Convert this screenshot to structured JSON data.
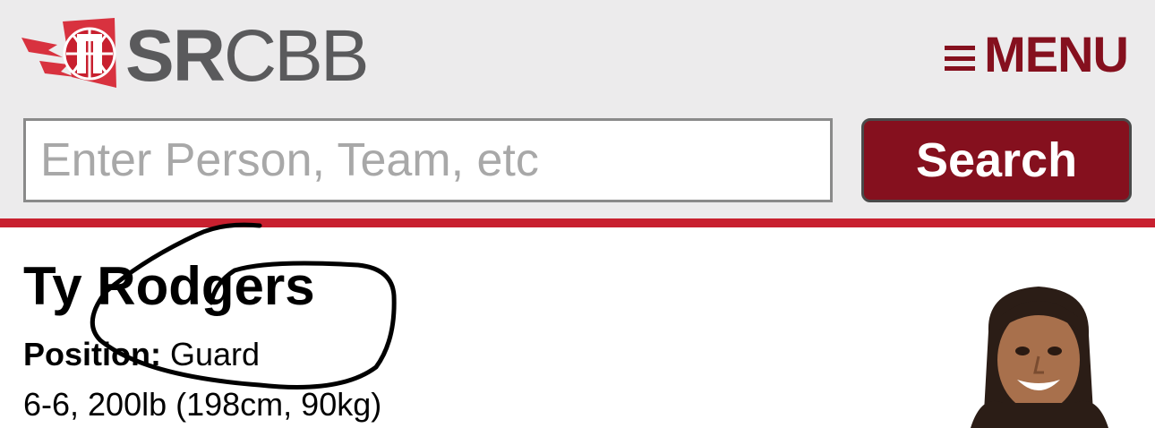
{
  "header": {
    "logo": {
      "bold": "SR",
      "light": "CBB"
    },
    "menu_label": "MENU"
  },
  "search": {
    "placeholder": "Enter Person, Team, etc",
    "value": "",
    "button_label": "Search"
  },
  "player": {
    "name": "Ty Rodgers",
    "position_label": "Position:",
    "position_value": "Guard",
    "size": "6-6, 200lb (198cm, 90kg)"
  },
  "colors": {
    "brand_red": "#85101e",
    "rule_red": "#c8202f",
    "header_bg": "#ecebec",
    "logo_gray": "#5a5a5c"
  },
  "icons": [
    "basketball-flag-logo-icon",
    "hamburger-menu-icon",
    "player-headshot",
    "pen-scribble-annotation"
  ]
}
